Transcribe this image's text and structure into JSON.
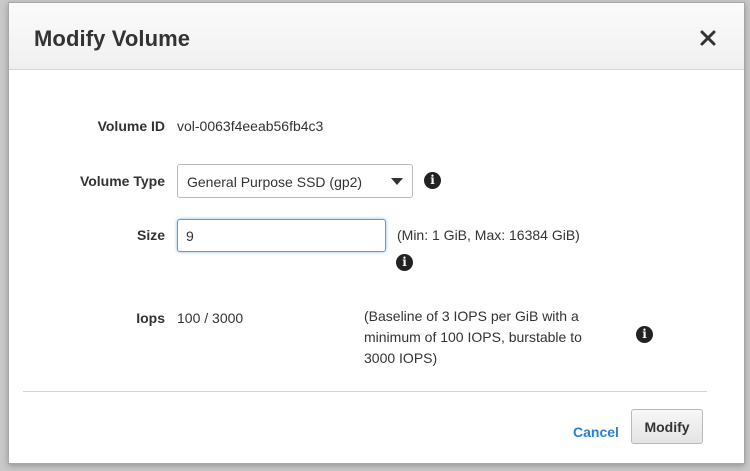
{
  "dialog": {
    "title": "Modify Volume",
    "close_icon": "close-icon"
  },
  "volume_id": {
    "label": "Volume ID",
    "value": "vol-0063f4eeab56fb4c3"
  },
  "volume_type": {
    "label": "Volume Type",
    "selected": "General Purpose SSD (gp2)",
    "info_icon": "info-icon"
  },
  "size": {
    "label": "Size",
    "value": "9",
    "hint": "(Min: 1 GiB, Max: 16384 GiB)",
    "info_icon": "info-icon"
  },
  "iops": {
    "label": "Iops",
    "value": "100 / 3000",
    "hint_lines": [
      "(Baseline of 3 IOPS per GiB with a",
      "minimum of 100 IOPS, burstable to",
      "3000 IOPS)"
    ],
    "info_icon": "info-icon"
  },
  "footer": {
    "cancel_label": "Cancel",
    "modify_label": "Modify"
  },
  "colors": {
    "link": "#2a7fd4",
    "focus_border": "#5b9dd9",
    "text": "#333333"
  }
}
